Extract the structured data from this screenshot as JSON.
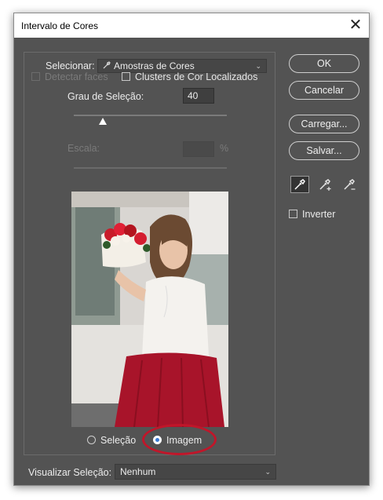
{
  "window": {
    "title": "Intervalo de Cores",
    "close_glyph": "✕"
  },
  "select_row": {
    "label": "Selecionar:",
    "value": "Amostras de Cores",
    "icon": "eyedropper-icon"
  },
  "options": {
    "detectar_faces": "Detectar faces",
    "clusters": "Clusters de Cor Localizados"
  },
  "fuzziness": {
    "label": "Grau de Seleção:",
    "value": "40",
    "level_percent": 20
  },
  "scale": {
    "label": "Escala:",
    "unit": "%"
  },
  "preview_mode": {
    "selection_label": "Seleção",
    "image_label": "Imagem",
    "selected": "image"
  },
  "view_selection": {
    "label": "Visualizar Seleção:",
    "value": "Nenhum"
  },
  "buttons": {
    "ok": "OK",
    "cancel": "Cancelar",
    "load": "Carregar...",
    "save": "Salvar..."
  },
  "tools": [
    "eyedropper-icon",
    "eyedropper-plus-icon",
    "eyedropper-minus-icon"
  ],
  "invert": {
    "label": "Inverter"
  },
  "colors": {
    "panel_bg": "#535353",
    "highlight": "#c0162a"
  }
}
